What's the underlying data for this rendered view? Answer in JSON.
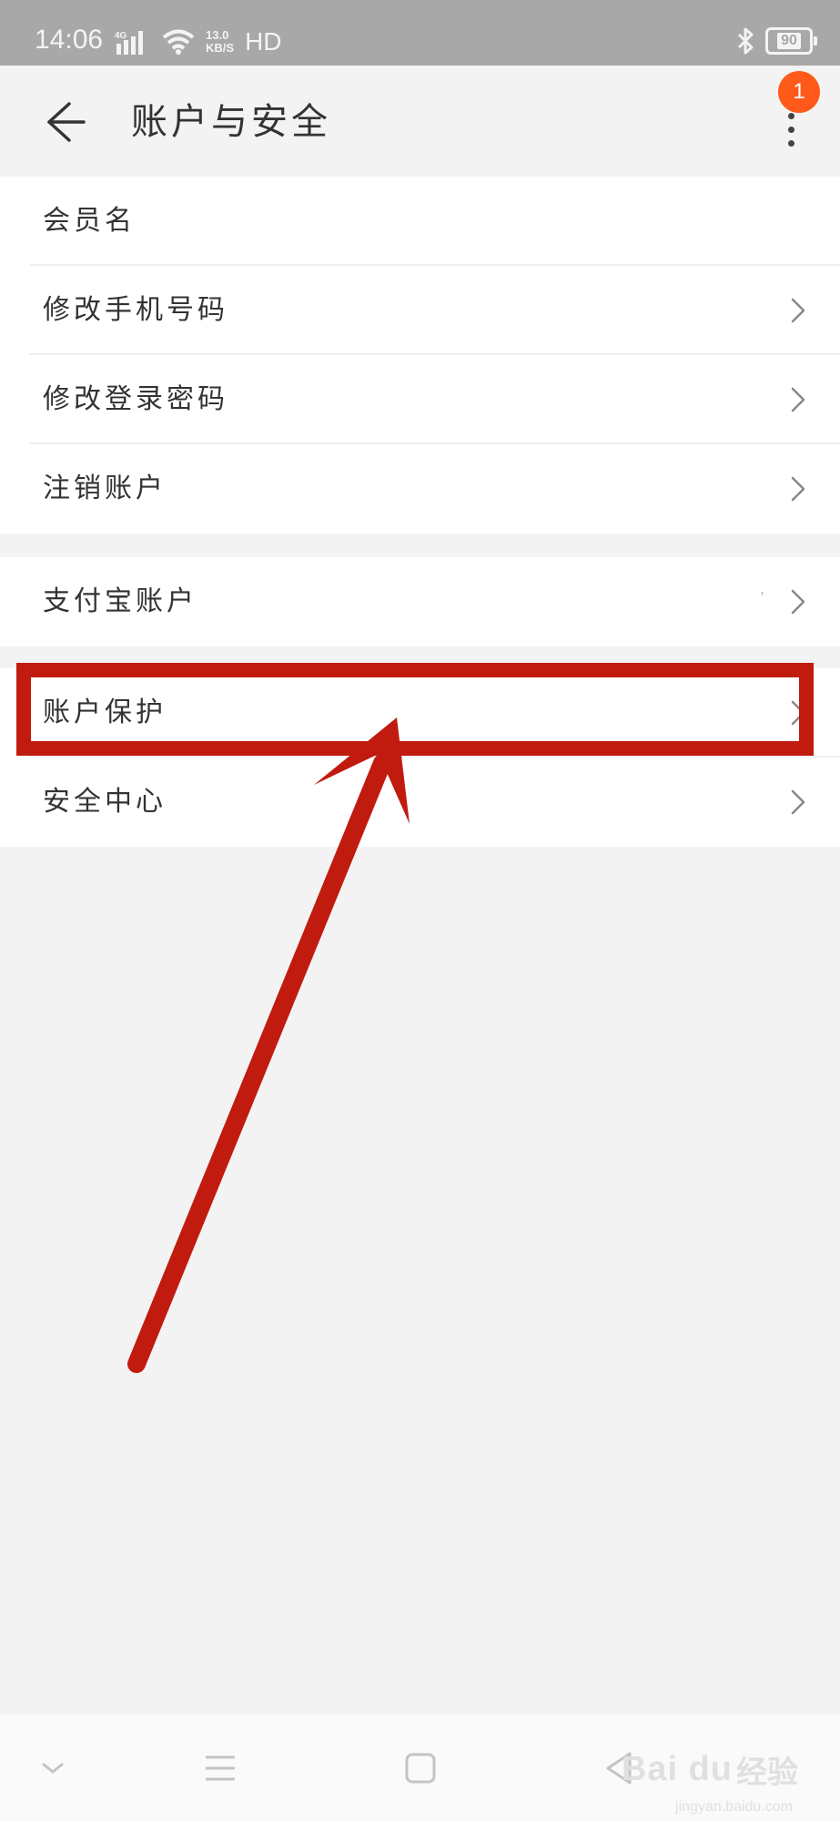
{
  "status_bar": {
    "time": "14:06",
    "network": "4G",
    "speed_value": "13.0",
    "speed_unit": "KB/S",
    "hd": "HD",
    "battery": "90",
    "icons": [
      "signal-icon",
      "wifi-icon",
      "bluetooth-icon",
      "battery-icon"
    ]
  },
  "header": {
    "back_icon": "back-arrow-icon",
    "title": "账户与安全",
    "more_icon": "more-vertical-icon",
    "badge_count": "1"
  },
  "groups": [
    {
      "items": [
        {
          "label": "会员名",
          "chevron": false
        },
        {
          "label": "修改手机号码",
          "chevron": true
        },
        {
          "label": "修改登录密码",
          "chevron": true
        },
        {
          "label": "注销账户",
          "chevron": true
        }
      ]
    },
    {
      "items": [
        {
          "label": "支付宝账户",
          "value": "'",
          "chevron": true
        }
      ]
    },
    {
      "items": [
        {
          "label": "账户保护",
          "chevron": true,
          "highlighted": true
        },
        {
          "label": "安全中心",
          "chevron": true
        }
      ]
    }
  ],
  "annotation": {
    "color": "#c11b10",
    "target": "账户保护"
  },
  "nav_bar": {
    "buttons": [
      "collapse-icon",
      "menu-icon",
      "home-icon",
      "back-icon"
    ]
  },
  "watermark": {
    "logo": "Bai du",
    "cn": "经验",
    "url": "jingyan.baidu.com"
  },
  "colors": {
    "accent_badge": "#ff5a1a",
    "annotation_red": "#c11b10",
    "background": "#f3f3f3",
    "status_bar": "#a8a8a8"
  }
}
